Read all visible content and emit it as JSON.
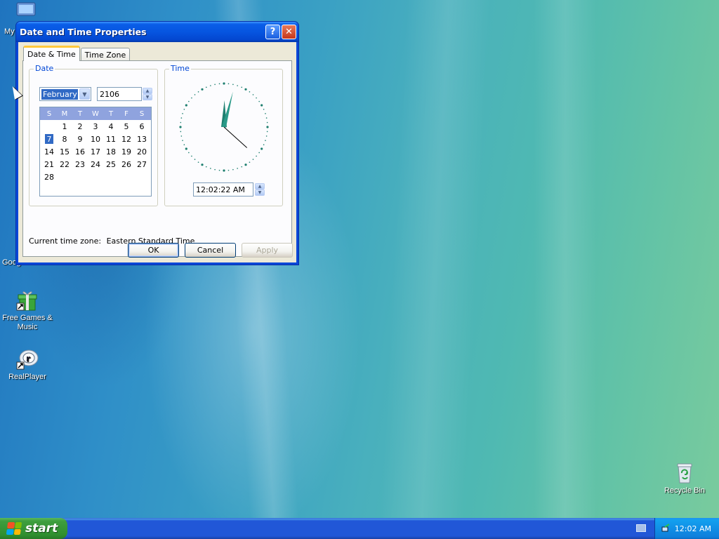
{
  "desktop": {
    "icons": [
      {
        "label": "Free Games & Music",
        "icon": "gift-icon"
      },
      {
        "label": "RealPlayer",
        "icon": "realplayer-icon"
      },
      {
        "label": "Recycle Bin",
        "icon": "recycle-bin-icon"
      }
    ],
    "partial_labels": {
      "my_computer": "My",
      "google": "Goog"
    }
  },
  "dialog": {
    "title": "Date and Time Properties",
    "help_label": "?",
    "close_label": "✕",
    "tabs": [
      {
        "label": "Date & Time",
        "active": true
      },
      {
        "label": "Time Zone",
        "active": false
      }
    ],
    "date_group_label": "Date",
    "time_group_label": "Time",
    "month_value": "February",
    "year_value": "2106",
    "weekday_headers": [
      "S",
      "M",
      "T",
      "W",
      "T",
      "F",
      "S"
    ],
    "calendar_offset": 1,
    "days": [
      "1",
      "2",
      "3",
      "4",
      "5",
      "6",
      "7",
      "8",
      "9",
      "10",
      "11",
      "12",
      "13",
      "14",
      "15",
      "16",
      "17",
      "18",
      "19",
      "20",
      "21",
      "22",
      "23",
      "24",
      "25",
      "26",
      "27",
      "28"
    ],
    "selected_day": "7",
    "time_value": "12:02:22 AM",
    "clock": {
      "hour": 12,
      "minute": 2,
      "second": 22
    },
    "timezone_label": "Current time zone:",
    "timezone_value": "Eastern Standard Time",
    "buttons": {
      "ok": "OK",
      "cancel": "Cancel",
      "apply": "Apply"
    }
  },
  "taskbar": {
    "start_label": "start",
    "clock": "12:02 AM"
  },
  "colors": {
    "title_bar": "#0a5ee8",
    "selection": "#316ac5",
    "group_label": "#0046d5",
    "calendar_header": "#8fa3de",
    "start_green": "#3e9e3e",
    "clock_tick": "#1e7f6f"
  }
}
